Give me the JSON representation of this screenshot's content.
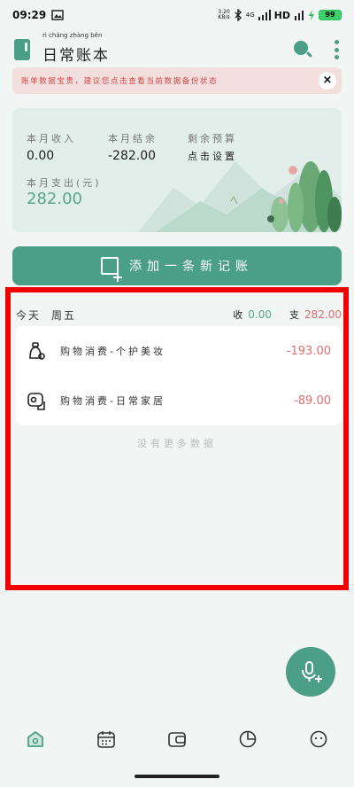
{
  "status_bar": {
    "time": "09:29",
    "net_speed": "3.20",
    "net_unit": "KB/s",
    "network": "4G",
    "hd": "HD",
    "battery": "99"
  },
  "app_bar": {
    "title": "日常账本",
    "title_pinyin": "rì cháng zhàng běn"
  },
  "banner": {
    "text": "账单数据宝贵，建议您点击查看当前数据备份状态",
    "close": "×"
  },
  "summary": {
    "income_label": "本月收入",
    "income_value": "0.00",
    "balance_label": "本月结余",
    "balance_value": "-282.00",
    "budget_label": "剩余预算",
    "budget_value": "点击设置",
    "expense_label": "本月支出(元)",
    "expense_value": "282.00"
  },
  "add_button": {
    "label": "添加一条新记账"
  },
  "day": {
    "label": "今天",
    "weekday": "周五",
    "income_label": "收",
    "income_value": "0.00",
    "expense_label": "支",
    "expense_value": "282.00"
  },
  "entries": [
    {
      "name": "购物消费-个护美妆",
      "amount": "-193.00",
      "icon": "cosmetics-icon"
    },
    {
      "name": "购物消费-日常家居",
      "amount": "-89.00",
      "icon": "toilet-paper-icon"
    }
  ],
  "no_more": "没有更多数据",
  "nav": [
    {
      "icon": "home-icon"
    },
    {
      "icon": "calendar-icon"
    },
    {
      "icon": "wallet-icon"
    },
    {
      "icon": "pie-chart-icon"
    },
    {
      "icon": "smiley-icon"
    }
  ],
  "colors": {
    "accent": "#4b9f86",
    "expense": "#e16d6d",
    "income": "#5aa68b",
    "highlight_border": "#f00000"
  }
}
